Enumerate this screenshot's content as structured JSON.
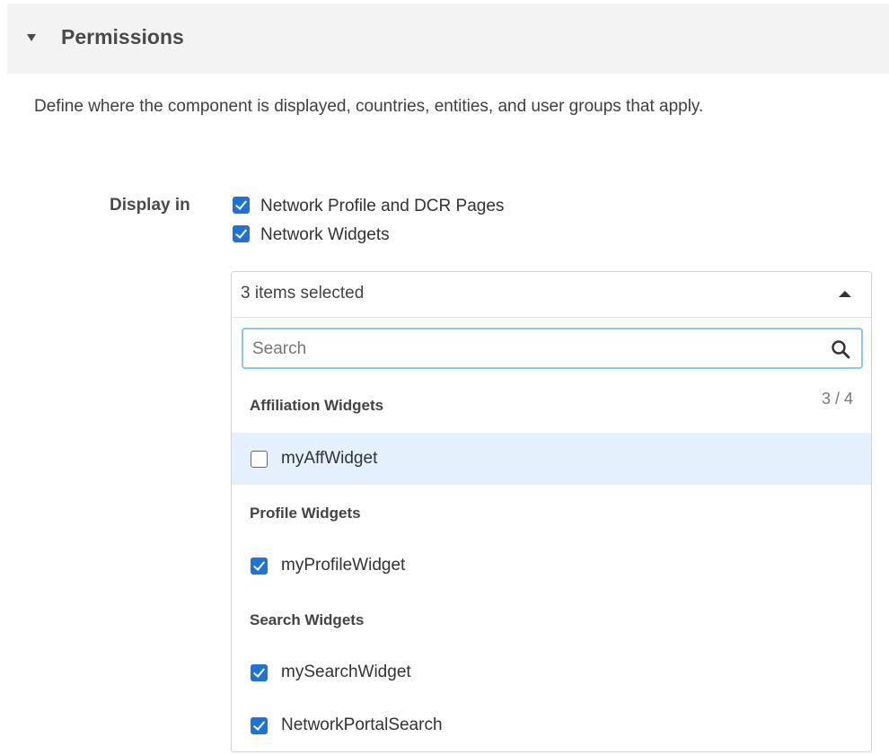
{
  "section": {
    "title": "Permissions",
    "description": "Define where the component is displayed, countries, entities, and user groups that apply."
  },
  "display_in": {
    "label": "Display in",
    "options": [
      {
        "label": "Network Profile and DCR Pages",
        "checked": true
      },
      {
        "label": "Network Widgets",
        "checked": true
      }
    ]
  },
  "dropdown": {
    "summary": "3 items selected",
    "search_placeholder": "Search",
    "count": "3 / 4",
    "groups": [
      {
        "title": "Affiliation Widgets",
        "items": [
          {
            "label": "myAffWidget",
            "checked": false,
            "highlighted": true
          }
        ]
      },
      {
        "title": "Profile Widgets",
        "items": [
          {
            "label": "myProfileWidget",
            "checked": true
          }
        ]
      },
      {
        "title": "Search Widgets",
        "items": [
          {
            "label": "mySearchWidget",
            "checked": true
          },
          {
            "label": "NetworkPortalSearch",
            "checked": true
          }
        ]
      }
    ]
  },
  "colors": {
    "accent": "#1e73d4",
    "highlight": "#e4f0fb",
    "header_bg": "#f3f3f3",
    "search_border": "#8fc6ef"
  },
  "icons": [
    "collapse-caret-icon",
    "chevron-up-icon",
    "search-icon",
    "checkbox-icon"
  ]
}
